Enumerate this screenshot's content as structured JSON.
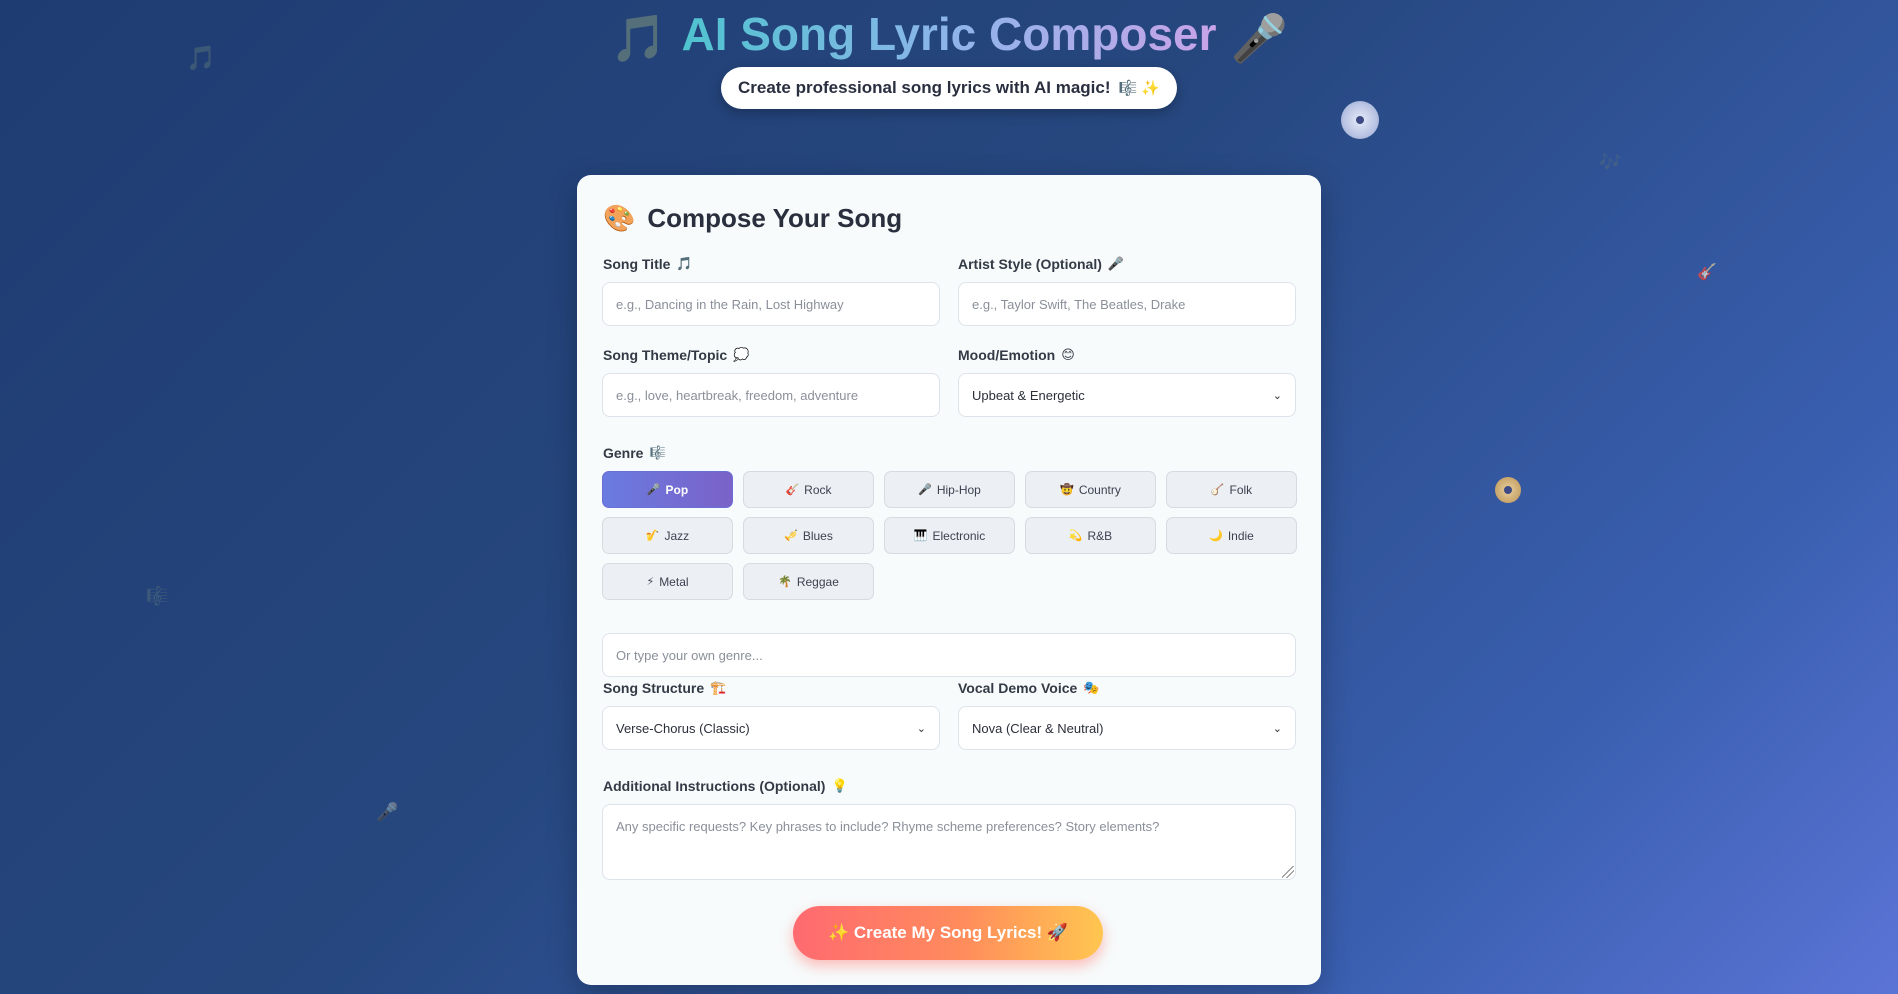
{
  "header": {
    "title": "AI Song Lyric Composer",
    "title_icon_left": "🎵",
    "title_icon_right": "🎤",
    "subtitle": "Create professional song lyrics with AI magic!",
    "subtitle_emoji": "🎼 ✨"
  },
  "decorations": {
    "note_icon": "🎵",
    "music_icon": "🎶",
    "guitar_icon": "🎸",
    "clef_icon": "🎼",
    "mic_icon": "🎤"
  },
  "form": {
    "heading": "Compose Your Song",
    "heading_icon": "🎨",
    "song_title": {
      "label": "Song Title",
      "emoji": "🎵",
      "value": "",
      "placeholder": "e.g., Dancing in the Rain, Lost Highway"
    },
    "artist_style": {
      "label": "Artist Style (Optional)",
      "emoji": "🎤",
      "value": "",
      "placeholder": "e.g., Taylor Swift, The Beatles, Drake"
    },
    "theme": {
      "label": "Song Theme/Topic",
      "emoji": "💭",
      "value": "",
      "placeholder": "e.g., love, heartbreak, freedom, adventure"
    },
    "mood": {
      "label": "Mood/Emotion",
      "emoji": "😊",
      "selected": "Upbeat & Energetic"
    },
    "genre": {
      "label": "Genre",
      "emoji": "🎼",
      "options": [
        {
          "emoji": "🎤",
          "label": "Pop",
          "active": true
        },
        {
          "emoji": "🎸",
          "label": "Rock",
          "active": false
        },
        {
          "emoji": "🎤",
          "label": "Hip-Hop",
          "active": false
        },
        {
          "emoji": "🤠",
          "label": "Country",
          "active": false
        },
        {
          "emoji": "🪕",
          "label": "Folk",
          "active": false
        },
        {
          "emoji": "🎷",
          "label": "Jazz",
          "active": false
        },
        {
          "emoji": "🎺",
          "label": "Blues",
          "active": false
        },
        {
          "emoji": "🎹",
          "label": "Electronic",
          "active": false
        },
        {
          "emoji": "💫",
          "label": "R&B",
          "active": false
        },
        {
          "emoji": "🌙",
          "label": "Indie",
          "active": false
        },
        {
          "emoji": "⚡",
          "label": "Metal",
          "active": false
        },
        {
          "emoji": "🌴",
          "label": "Reggae",
          "active": false
        }
      ],
      "custom_value": "",
      "custom_placeholder": "Or type your own genre..."
    },
    "structure": {
      "label": "Song Structure",
      "emoji": "🏗️",
      "selected": "Verse-Chorus (Classic)"
    },
    "voice": {
      "label": "Vocal Demo Voice",
      "emoji": "🎭",
      "selected": "Nova (Clear & Neutral)"
    },
    "instructions": {
      "label": "Additional Instructions (Optional)",
      "emoji": "💡",
      "value": "",
      "placeholder": "Any specific requests? Key phrases to include? Rhyme scheme preferences? Story elements?"
    },
    "submit_label": "✨ Create My Song Lyrics! 🚀"
  },
  "colors": {
    "background_start": "#1f3c72",
    "background_end": "#5b74d6",
    "card": "#f7fbfc",
    "genre_active": "#6a7be0",
    "button_start": "#ff6a70",
    "button_end": "#ffc650"
  }
}
